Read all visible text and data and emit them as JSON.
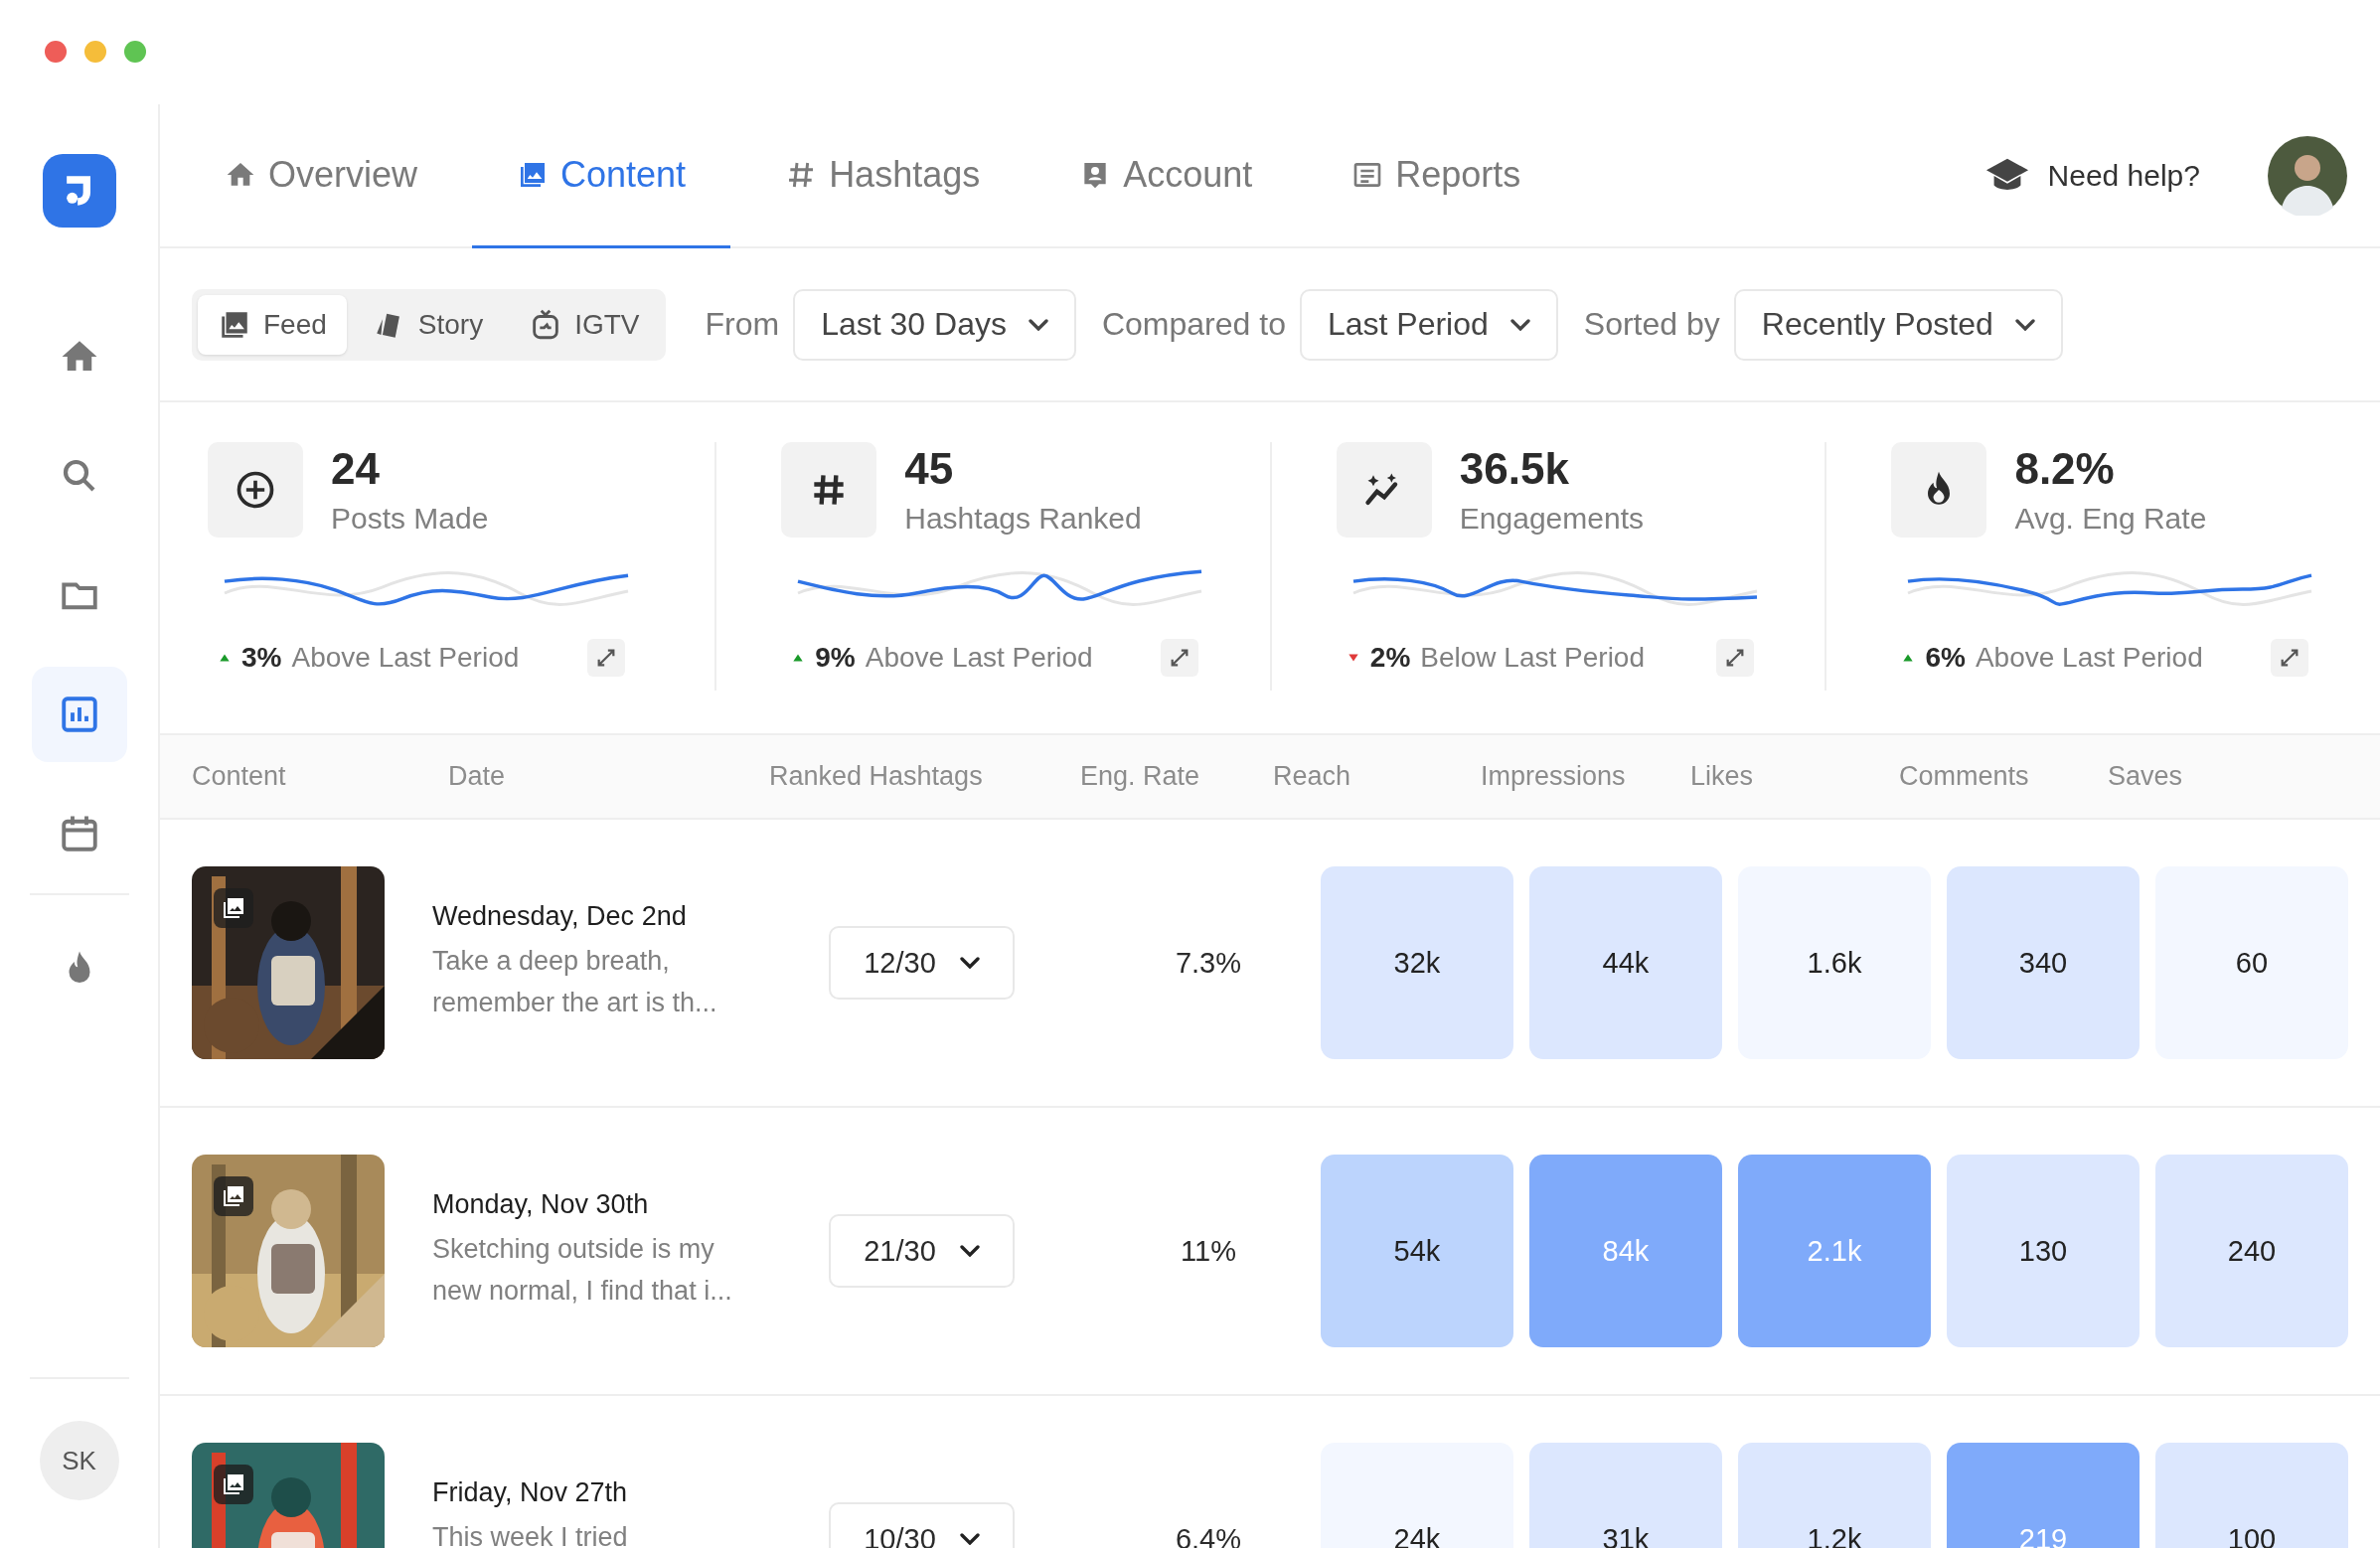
{
  "sidebar": {
    "items": [
      {
        "selected": false
      },
      {
        "selected": false
      },
      {
        "selected": false
      },
      {
        "selected": true
      },
      {
        "selected": false
      },
      {
        "selected": false
      }
    ],
    "user_initials": "SK"
  },
  "tabs": [
    {
      "label": "Overview",
      "selected": false
    },
    {
      "label": "Content",
      "selected": true
    },
    {
      "label": "Hashtags",
      "selected": false
    },
    {
      "label": "Account",
      "selected": false
    },
    {
      "label": "Reports",
      "selected": false
    }
  ],
  "help": "Need help?",
  "content_types": [
    {
      "label": "Feed",
      "selected": true
    },
    {
      "label": "Story",
      "selected": false
    },
    {
      "label": "IGTV",
      "selected": false
    }
  ],
  "filters": [
    {
      "label": "From",
      "value": "Last 30 Days"
    },
    {
      "label": "Compared to",
      "value": "Last Period"
    },
    {
      "label": "Sorted by",
      "value": "Recently Posted"
    }
  ],
  "stats": [
    {
      "value": "24",
      "label": "Posts Made",
      "kind": "up",
      "change": "3%",
      "comparison": "Above Last Period"
    },
    {
      "value": "45",
      "label": "Hashtags Ranked",
      "kind": "up",
      "change": "9%",
      "comparison": "Above Last Period"
    },
    {
      "value": "36.5k",
      "label": "Engagements",
      "kind": "down",
      "change": "2%",
      "comparison": "Below Last Period"
    },
    {
      "value": "8.2%",
      "label": "Avg. Eng Rate",
      "kind": "up",
      "change": "6%",
      "comparison": "Above Last Period"
    }
  ],
  "table": {
    "columns": [
      "Content",
      "Date",
      "Ranked Hashtags",
      "Eng. Rate",
      "Reach",
      "Impressions",
      "Likes",
      "Comments",
      "Saves"
    ],
    "rows": [
      {
        "thumbnail": {
          "kind": "picture"
        },
        "day": "Wednesday,",
        "date": "Dec 2nd",
        "caption": "Take a deep breath, remember the art is th...",
        "hashtags": "12/30",
        "eng_rate": "7.3%",
        "metrics": [
          {
            "value": "32k",
            "color": "#dce7fe"
          },
          {
            "value": "44k",
            "color": "#dce7fe"
          },
          {
            "value": "1.6k",
            "color": "#f3f7ff"
          },
          {
            "value": "340",
            "color": "#dce7fe"
          },
          {
            "value": "60",
            "color": "#f3f7ff"
          }
        ]
      },
      {
        "thumbnail": {
          "kind": "picture"
        },
        "day": "Monday,",
        "date": "Nov 30th",
        "caption": "Sketching outside is my new normal, I find that i...",
        "hashtags": "21/30",
        "eng_rate": "11%",
        "metrics": [
          {
            "value": "54k",
            "color": "#bcd4fd"
          },
          {
            "value": "84k",
            "color": "#7faafa"
          },
          {
            "value": "2.1k",
            "color": "#7faafa"
          },
          {
            "value": "130",
            "color": "#dce7fe"
          },
          {
            "value": "240",
            "color": "#dce7fe"
          }
        ]
      },
      {
        "thumbnail": {
          "kind": "picture"
        },
        "day": "Friday,",
        "date": "Nov 27th",
        "caption": "This week I tried",
        "hashtags": "10/30",
        "eng_rate": "6.4%",
        "metrics": [
          {
            "value": "24k",
            "color": "#f3f7ff"
          },
          {
            "value": "31k",
            "color": "#dce7fe"
          },
          {
            "value": "1.2k",
            "color": "#dce7fe"
          },
          {
            "value": "219",
            "color": "#7faafa"
          },
          {
            "value": "100",
            "color": "#dce7fe"
          }
        ]
      }
    ]
  }
}
